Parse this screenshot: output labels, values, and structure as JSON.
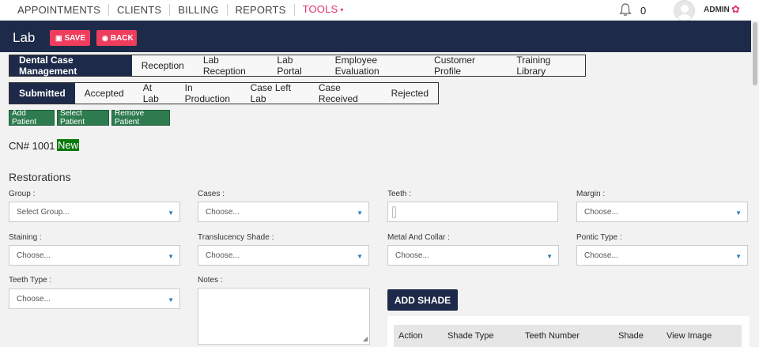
{
  "topnav": {
    "links": [
      "APPOINTMENTS",
      "CLIENTS",
      "BILLING",
      "REPORTS",
      "TOOLS"
    ],
    "tools_caret": "▾",
    "notification_count": "0",
    "user_label": "ADMIN",
    "gear": "✿"
  },
  "header": {
    "title": "Lab",
    "save_label": "SAVE",
    "back_label": "BACK",
    "save_icon": "▣",
    "back_icon": "◉"
  },
  "tabs_primary": [
    {
      "label": "Dental Case Management",
      "active": true
    },
    {
      "label": "Reception",
      "active": false
    },
    {
      "label": "Lab Reception",
      "active": false
    },
    {
      "label": "Lab Portal",
      "active": false
    },
    {
      "label": "Employee Evaluation",
      "active": false
    },
    {
      "label": "Customer Profile",
      "active": false
    },
    {
      "label": "Training Library",
      "active": false
    }
  ],
  "tabs_status": [
    {
      "label": "Submitted",
      "active": true
    },
    {
      "label": "Accepted",
      "active": false
    },
    {
      "label": "At Lab",
      "active": false
    },
    {
      "label": "In Production",
      "active": false
    },
    {
      "label": "Case Left Lab",
      "active": false
    },
    {
      "label": "Case Received",
      "active": false
    },
    {
      "label": "Rejected",
      "active": false
    }
  ],
  "patient_buttons": {
    "add": "Add Patient",
    "select": "Select Patient",
    "remove": "Remove Patient"
  },
  "case": {
    "number_label": "CN# 1001",
    "status": "New"
  },
  "restorations": {
    "title": "Restorations",
    "group_label": "Group :",
    "group_value": "Select Group...",
    "cases_label": "Cases :",
    "cases_value": "Choose...",
    "teeth_label": "Teeth :",
    "margin_label": "Margin :",
    "margin_value": "Choose...",
    "staining_label": "Staining :",
    "staining_value": "Choose...",
    "translucency_label": "Translucency Shade :",
    "translucency_value": "Choose...",
    "metal_label": "Metal And Collar :",
    "metal_value": "Choose...",
    "pontic_label": "Pontic Type :",
    "pontic_value": "Choose...",
    "teeth_type_label": "Teeth Type :",
    "teeth_type_value": "Choose...",
    "notes_label": "Notes :",
    "add_shade_label": "ADD SHADE"
  },
  "shade_table": {
    "columns": [
      "Action",
      "Shade Type",
      "Teeth Number",
      "Shade",
      "View Image"
    ]
  },
  "colors": {
    "navy": "#1e2a49",
    "pink": "#ee3d5d",
    "green": "#2e7b4f"
  }
}
